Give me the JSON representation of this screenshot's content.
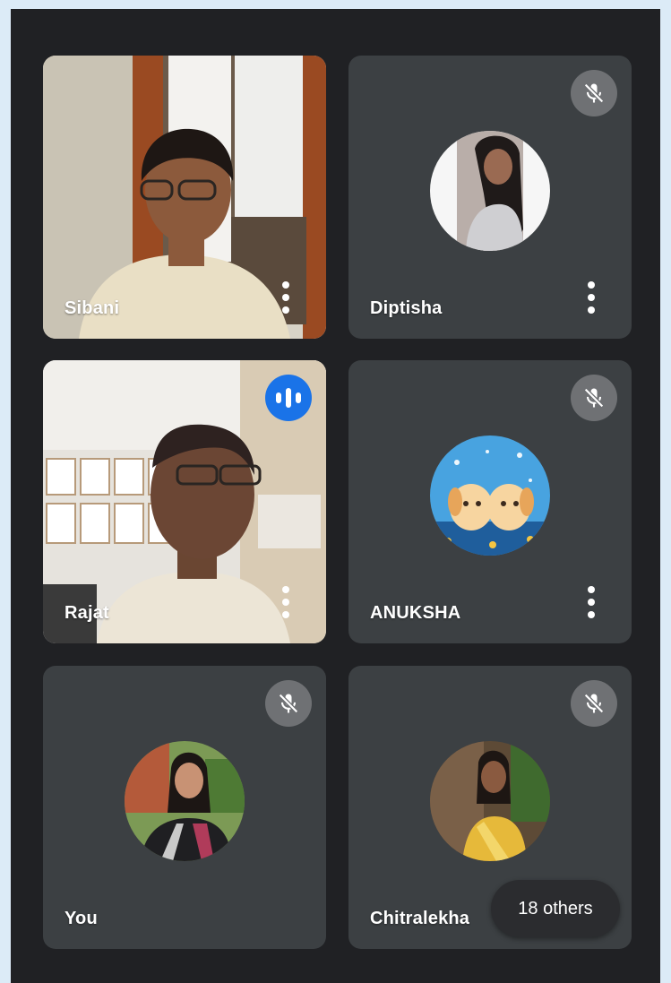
{
  "participants": [
    {
      "name": "Sibani",
      "muted": false,
      "video": true
    },
    {
      "name": "Diptisha",
      "muted": true,
      "video": false
    },
    {
      "name": "Rajat",
      "muted": false,
      "speaking": true,
      "video": true
    },
    {
      "name": "ANUKSHA",
      "muted": true,
      "video": false
    },
    {
      "name": "You",
      "muted": true,
      "video": false
    },
    {
      "name": "Chitralekha",
      "muted": true,
      "video": false
    }
  ],
  "others_label": "18 others",
  "colors": {
    "background": "#202124",
    "tile": "#3c4043",
    "speaking": "#1a73e8",
    "mic_off": "#6f7174"
  },
  "icons": [
    "mic-off-icon",
    "audio-level-icon",
    "more-options-icon"
  ]
}
